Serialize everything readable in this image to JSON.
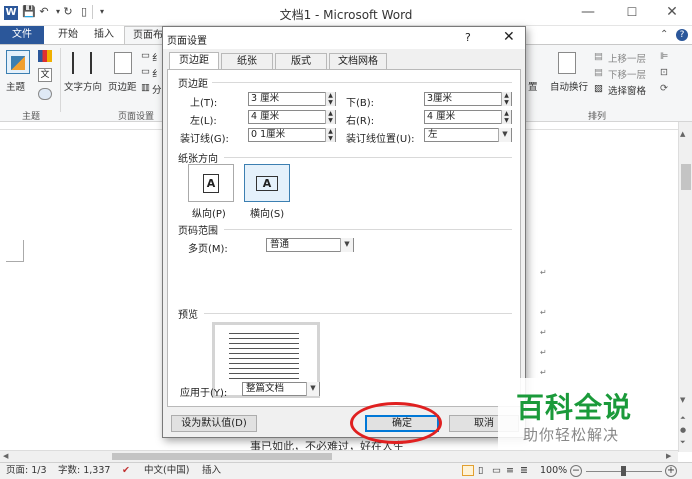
{
  "window": {
    "title": "文档1 - Microsoft Word",
    "app_icon": "W",
    "controls": {
      "minimize": "—",
      "maximize": "☐",
      "close": "✕"
    }
  },
  "quick_access": {
    "save_icon": "save-icon",
    "undo_icon": "undo-icon",
    "redo_icon": "redo-icon",
    "new_icon": "new-doc-icon",
    "customize": "▾"
  },
  "ribbon_tabs": [
    "文件",
    "开始",
    "插入",
    "页面布"
  ],
  "ribbon": {
    "theme_label": "主题",
    "theme_group": "主题",
    "text_direction": "文字方向",
    "margins": "页边距",
    "page_setup_group": "页面设置",
    "partial_labels": [
      "纟",
      "纟",
      "分"
    ],
    "position_label": "置",
    "wrap_label": "自动换行",
    "bring_forward": "上移一层",
    "send_backward": "下移一层",
    "selection_pane": "选择窗格",
    "arrange_group": "排列",
    "collapse": "⌃",
    "help": "?"
  },
  "dialog": {
    "title": "页面设置",
    "help": "?",
    "close": "✕",
    "tabs": [
      "页边距",
      "纸张",
      "版式",
      "文档网格"
    ],
    "margins_section": "页边距",
    "top_label": "上(T):",
    "top_value": "3 厘米",
    "bottom_label": "下(B):",
    "bottom_value": "3厘米",
    "left_label": "左(L):",
    "left_value": "4 厘米",
    "right_label": "右(R):",
    "right_value": "4 厘米",
    "gutter_label": "装订线(G):",
    "gutter_value": "0 1厘米",
    "gutter_pos_label": "装订线位置(U):",
    "gutter_pos_value": "左",
    "orientation_section": "纸张方向",
    "portrait_label": "纵向(P)",
    "landscape_label": "横向(S)",
    "pages_section": "页码范围",
    "multiple_pages_label": "多页(M):",
    "multiple_pages_value": "普通",
    "preview_section": "预览",
    "apply_to_label": "应用于(Y):",
    "apply_to_value": "整篇文档",
    "set_default": "设为默认值(D)",
    "ok": "确定",
    "cancel": "取消"
  },
  "document": {
    "fragment": "事已如此，不必难过，好在人生"
  },
  "statusbar": {
    "page": "页面: 1/3",
    "words": "字数: 1,337",
    "language": "中文(中国)",
    "mode": "插入",
    "zoom": "100%",
    "zoom_out": "−",
    "zoom_in": "+"
  },
  "watermark": {
    "title": "百科全说",
    "subtitle": "助你轻松解决"
  },
  "colors": {
    "accent": "#2b579a",
    "watermark_green": "#1a9a3a",
    "highlight_red": "#e02020"
  }
}
